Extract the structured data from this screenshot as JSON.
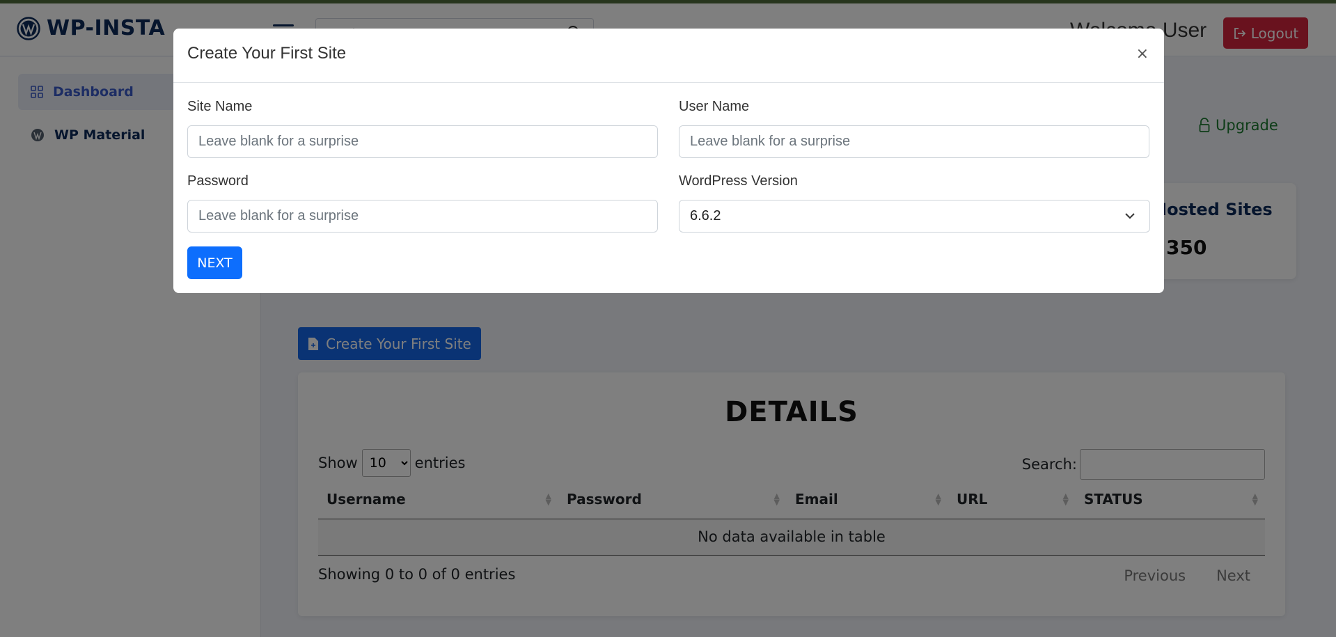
{
  "app": {
    "logo_text": "WP-INSTA"
  },
  "header": {
    "search_placeholder": "Search",
    "welcome_text": "Welcome User",
    "logout_label": "Logout"
  },
  "sidebar": {
    "items": [
      {
        "label": "Dashboard",
        "icon": "grid-icon",
        "active": true
      },
      {
        "label": "WP Material",
        "icon": "wordpress-icon",
        "active": false
      }
    ]
  },
  "main": {
    "upgrade_label": "Upgrade",
    "hosted_sites_label": "Hosted Sites",
    "hosted_sites_count": "350",
    "create_button_label": "Create Your First Site",
    "details": {
      "title": "DETAILS",
      "show_label": "Show",
      "entries_label": "entries",
      "page_length": "10",
      "search_label": "Search:",
      "columns": [
        "Username",
        "Password",
        "Email",
        "URL",
        "STATUS"
      ],
      "empty_message": "No data available in table",
      "info": "Showing 0 to 0 of 0 entries",
      "previous_label": "Previous",
      "next_label": "Next"
    }
  },
  "modal": {
    "title": "Create Your First Site",
    "close_label": "×",
    "site_name_label": "Site Name",
    "site_name_placeholder": "Leave blank for a surprise",
    "user_name_label": "User Name",
    "user_name_placeholder": "Leave blank for a surprise",
    "password_label": "Password",
    "password_placeholder": "Leave blank for a surprise",
    "wp_version_label": "WordPress Version",
    "wp_version_value": "6.6.2",
    "next_label": "NEXT"
  },
  "colors": {
    "brand_navy": "#0d2a5a",
    "primary_blue": "#0d6efd",
    "logout_red": "#d2243c",
    "upgrade_green": "#1d7a30"
  }
}
